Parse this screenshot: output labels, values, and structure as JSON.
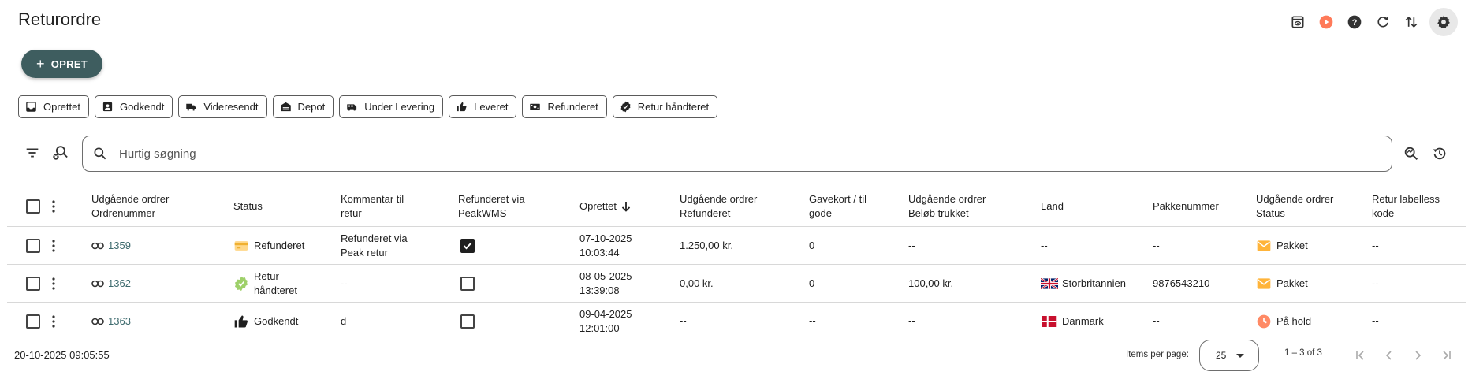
{
  "header": {
    "title": "Returordre",
    "icons": [
      "preview-icon",
      "play-icon",
      "help-icon",
      "refresh-icon",
      "sort-arrows-icon",
      "settings-icon"
    ],
    "accent_orange": "#ff7a59"
  },
  "create_button": {
    "label": "OPRET",
    "color": "#3e5d5f"
  },
  "chips": [
    {
      "label": "Oprettet",
      "icon": "inbox-icon"
    },
    {
      "label": "Godkendt",
      "icon": "badge-icon"
    },
    {
      "label": "Videresendt",
      "icon": "truck-icon"
    },
    {
      "label": "Depot",
      "icon": "warehouse-icon"
    },
    {
      "label": "Under Levering",
      "icon": "van-icon"
    },
    {
      "label": "Leveret",
      "icon": "thumb-up-icon"
    },
    {
      "label": "Refunderet",
      "icon": "cash-icon"
    },
    {
      "label": "Retur håndteret",
      "icon": "verified-icon"
    }
  ],
  "search": {
    "placeholder": "Hurtig søgning"
  },
  "table": {
    "columns": {
      "ordernummer": "Udgående ordrer Ordrenummer",
      "status": "Status",
      "kommentar": "Kommentar til retur",
      "refunderet_via": "Refunderet via PeakWMS",
      "oprettet": "Oprettet",
      "udg_refunderet": "Udgående ordrer Refunderet",
      "gavekort": "Gavekort / til gode",
      "belob": "Udgående ordrer Beløb trukket",
      "land": "Land",
      "pakkenummer": "Pakkenummer",
      "udg_status": "Udgående ordrer Status",
      "labelless": "Retur labelless kode"
    },
    "sort_indicator": "descending",
    "rows": [
      {
        "order": "1359",
        "status": "Refunderet",
        "status_icon": "refund-card-icon",
        "comment": "Refunderet via Peak retur",
        "refunded_via_peak": true,
        "created": "07-10-2025 10:03:44",
        "refunded": "1.250,00 kr.",
        "giftcard": "0",
        "amount": "--",
        "country": "--",
        "country_flag": "",
        "package": "--",
        "out_status": "Pakket",
        "out_status_icon": "envelope-icon",
        "labelless": "--"
      },
      {
        "order": "1362",
        "status": "Retur håndteret",
        "status_icon": "verified-green-icon",
        "comment": "--",
        "refunded_via_peak": false,
        "created": "08-05-2025 13:39:08",
        "refunded": "0,00 kr.",
        "giftcard": "0",
        "amount": "100,00 kr.",
        "country": "Storbritannien",
        "country_flag": "uk-flag-icon",
        "package": "9876543210",
        "out_status": "Pakket",
        "out_status_icon": "envelope-icon",
        "labelless": "--"
      },
      {
        "order": "1363",
        "status": "Godkendt",
        "status_icon": "thumb-up-icon",
        "comment": "d",
        "refunded_via_peak": false,
        "created": "09-04-2025 12:01:00",
        "refunded": "--",
        "giftcard": "--",
        "amount": "--",
        "country": "Danmark",
        "country_flag": "denmark-flag-icon",
        "package": "--",
        "out_status": "På hold",
        "out_status_icon": "clock-icon",
        "labelless": "--"
      }
    ]
  },
  "footer": {
    "timestamp": "20-10-2025 09:05:55",
    "items_per_page_label": "Items per page:",
    "items_per_page": "25",
    "range": "1 – 3 of 3"
  }
}
